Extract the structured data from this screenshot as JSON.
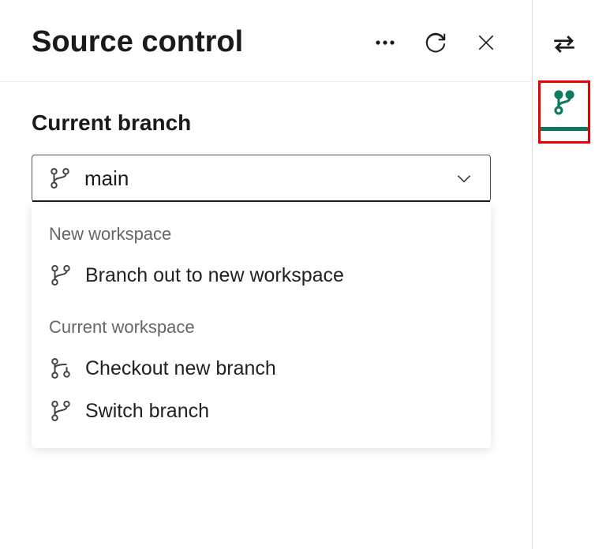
{
  "header": {
    "title": "Source control"
  },
  "section": {
    "current_branch_label": "Current branch"
  },
  "dropdown": {
    "value": "main",
    "groups": {
      "new_workspace_label": "New workspace",
      "current_workspace_label": "Current workspace"
    },
    "items": {
      "branch_out": "Branch out to new workspace",
      "checkout_new": "Checkout new branch",
      "switch_branch": "Switch branch"
    }
  }
}
